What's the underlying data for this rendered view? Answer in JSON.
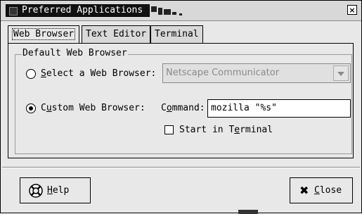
{
  "window": {
    "title": "Preferred Applications",
    "close_symbol": "×"
  },
  "tabs": [
    {
      "label": "Web Browser",
      "active": true
    },
    {
      "label": "Text Editor",
      "active": false
    },
    {
      "label": "Terminal",
      "active": false
    }
  ],
  "group": {
    "title": "Default Web Browser"
  },
  "select_browser": {
    "label_pre": "",
    "label_accel": "S",
    "label_post": "elect a Web Browser:",
    "selected": false,
    "combo_value": "Netscape Communicator",
    "combo_enabled": false
  },
  "custom_browser": {
    "label_pre": "C",
    "label_accel": "u",
    "label_post": "stom Web Browser:",
    "selected": true,
    "command_label_pre": "C",
    "command_label_accel": "o",
    "command_label_post": "mmand:",
    "command_value": "mozilla \"%s\""
  },
  "start_in_terminal": {
    "label_pre": "Start in T",
    "label_accel": "e",
    "label_post": "rminal",
    "checked": false
  },
  "buttons": {
    "help": {
      "label_accel": "H",
      "label_post": "elp",
      "icon": "help-lifebuoy-icon"
    },
    "close": {
      "label_accel": "C",
      "label_post": "lose",
      "icon": "close-x-icon",
      "symbol": "✖"
    }
  }
}
